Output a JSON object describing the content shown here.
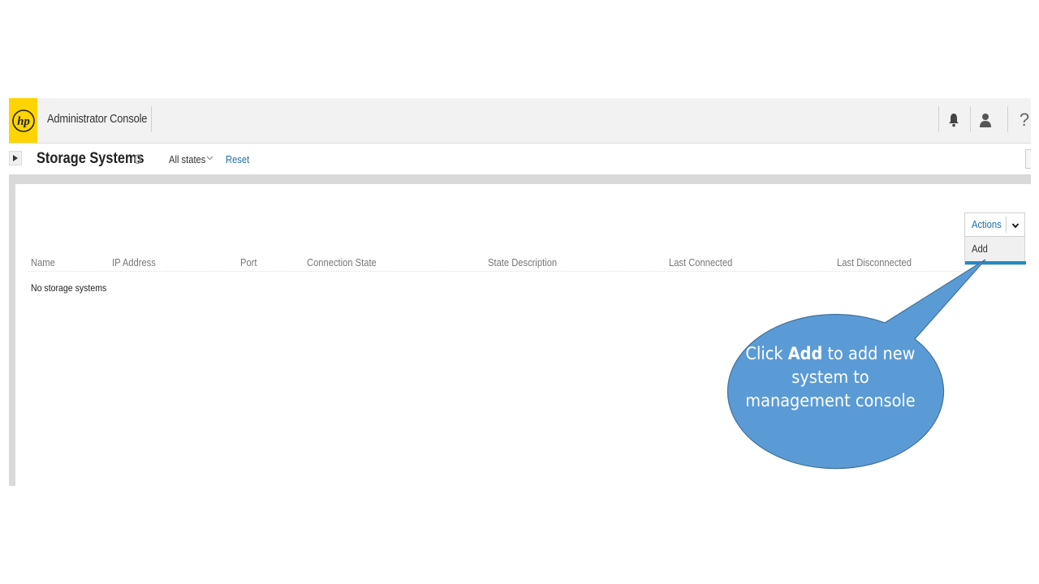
{
  "header": {
    "logo_text": "hp",
    "app_title": "Administrator Console",
    "help_label": "?",
    "icons": [
      "bell-icon",
      "user-icon",
      "help-icon"
    ]
  },
  "subheader": {
    "title": "Storage Systems",
    "count": "0",
    "filter_label": "All states",
    "reset_label": "Reset"
  },
  "actions": {
    "label": "Actions",
    "menu_items": [
      "Add"
    ]
  },
  "table": {
    "columns": [
      "Name",
      "IP Address",
      "Port",
      "Connection State",
      "State Description",
      "Last Connected",
      "Last Disconnected"
    ],
    "empty_message": "No storage systems"
  },
  "callout": {
    "prefix": "Click ",
    "bold": "Add",
    "suffix": " to add new system to management console"
  },
  "colors": {
    "logo_yellow": "#ffd400",
    "link_blue": "#1f6fa6",
    "accent_blue": "#1e8cc8",
    "callout_fill": "#5b9bd5",
    "callout_stroke": "#41719c"
  }
}
